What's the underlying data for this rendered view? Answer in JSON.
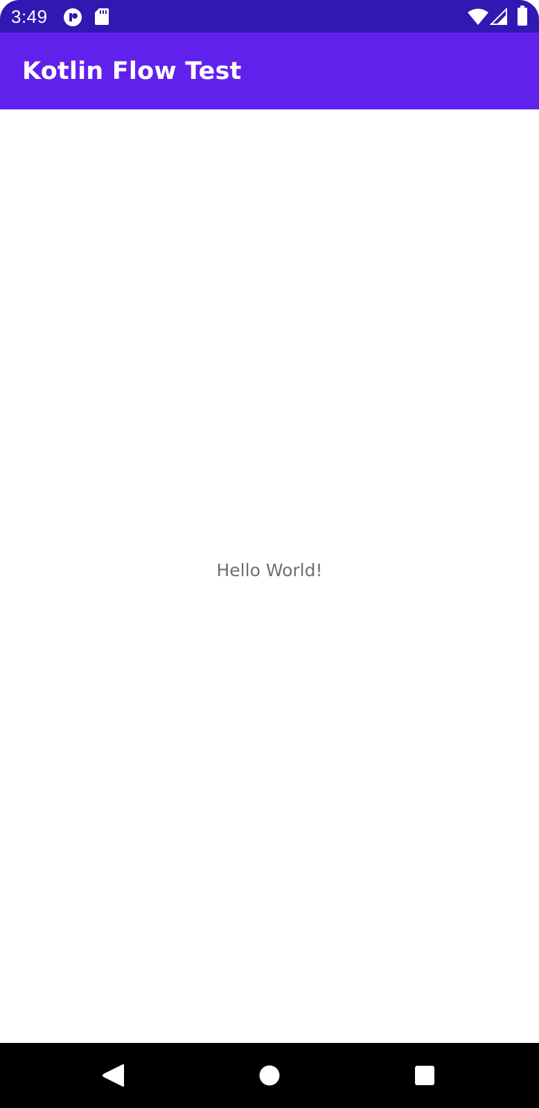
{
  "status_bar": {
    "time": "3:49",
    "left_icons": [
      "app-notification-icon",
      "sd-card-icon"
    ],
    "right_icons": [
      "wifi-icon",
      "cell-signal-icon",
      "battery-icon"
    ],
    "color": "#3018b2"
  },
  "app_bar": {
    "title": "Kotlin Flow Test",
    "color": "#6021ec"
  },
  "main": {
    "message": "Hello World!"
  },
  "nav_bar": {
    "buttons": [
      "back-icon",
      "home-icon",
      "recents-icon"
    ]
  }
}
